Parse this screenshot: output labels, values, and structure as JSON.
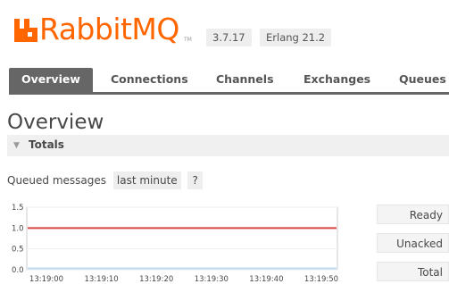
{
  "brand": {
    "name": "RabbitMQ",
    "tm": "TM",
    "accent_color": "#ff6600"
  },
  "versions": {
    "rabbitmq": "3.7.17",
    "erlang": "Erlang 21.2"
  },
  "tabs": [
    {
      "label": "Overview",
      "active": true
    },
    {
      "label": "Connections",
      "active": false
    },
    {
      "label": "Channels",
      "active": false
    },
    {
      "label": "Exchanges",
      "active": false
    },
    {
      "label": "Queues",
      "active": false
    }
  ],
  "page": {
    "title": "Overview",
    "section": "Totals"
  },
  "queued_messages": {
    "label": "Queued messages",
    "range": "last minute",
    "help": "?"
  },
  "legend": {
    "ready": "Ready",
    "unacked": "Unacked",
    "total": "Total"
  },
  "chart_data": {
    "type": "line",
    "x": [
      "13:19:00",
      "13:19:10",
      "13:19:20",
      "13:19:30",
      "13:19:40",
      "13:19:50"
    ],
    "ylim": [
      0,
      1.5
    ],
    "yticks": [
      "1.5",
      "1.0",
      "0.5",
      "0.0"
    ],
    "series": [
      {
        "name": "Ready",
        "values": [
          1,
          1,
          1,
          1,
          1,
          1
        ],
        "color": "#dd4444"
      },
      {
        "name": "Unacked",
        "values": [
          0,
          0,
          0,
          0,
          0,
          0
        ],
        "color": "#bcd9f0"
      }
    ],
    "grid": true
  }
}
